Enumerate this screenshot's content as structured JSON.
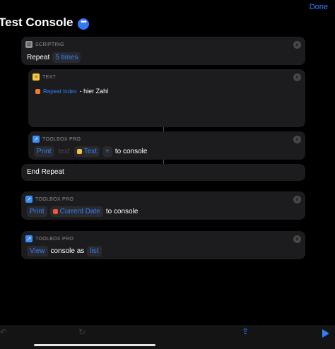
{
  "header": {
    "done_label": "Done",
    "title": "Test Console"
  },
  "repeat_card": {
    "category": "SCRIPTING",
    "label": "Repeat",
    "count": "5 times"
  },
  "text_card": {
    "category": "TEXT",
    "variable": "Repeat Index",
    "content": "- hier Zahl"
  },
  "print_card_1": {
    "category": "TOOLBOX PRO",
    "action": "Print",
    "placeholder": "text",
    "variable": "Text",
    "add": "+",
    "suffix": "to console"
  },
  "end_repeat": {
    "label": "End Repeat"
  },
  "print_card_2": {
    "category": "TOOLBOX PRO",
    "action": "Print",
    "variable": "Current Date",
    "suffix": "to console"
  },
  "view_card": {
    "category": "TOOLBOX PRO",
    "action": "View",
    "middle": "console as",
    "format": "list"
  },
  "colors": {
    "accent": "#2f80f7",
    "card": "#1c1c1e",
    "background": "#000000"
  }
}
